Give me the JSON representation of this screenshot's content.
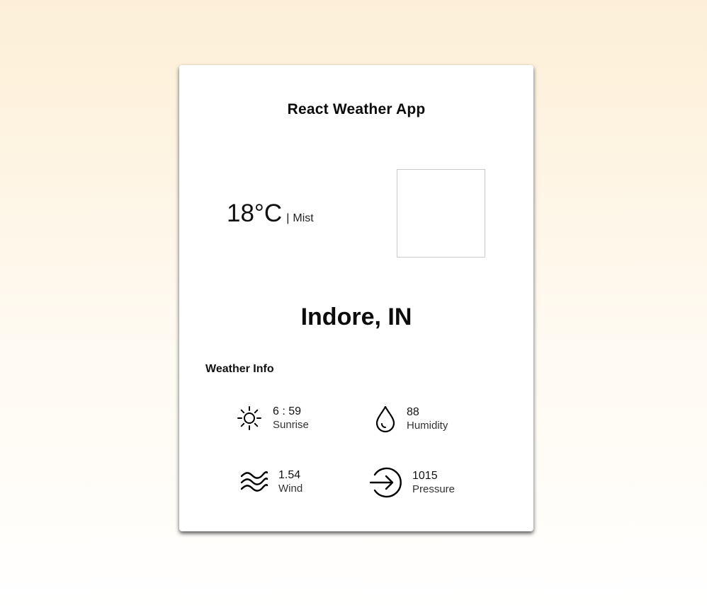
{
  "app": {
    "title": "React Weather App"
  },
  "weather": {
    "temperature": "18°C",
    "separator": "|",
    "condition": "Mist",
    "city": "Indore, IN"
  },
  "info": {
    "heading": "Weather Info",
    "items": [
      {
        "value": "6 : 59",
        "label": "Sunrise",
        "icon": "sun-icon"
      },
      {
        "value": "88",
        "label": "Humidity",
        "icon": "water-drop-icon"
      },
      {
        "value": "1.54",
        "label": "Wind",
        "icon": "wind-waves-icon"
      },
      {
        "value": "1015",
        "label": "Pressure",
        "icon": "arrow-circle-icon"
      }
    ]
  },
  "colors": {
    "background_top": "#fdefd7",
    "background_bottom": "#ffffff",
    "card": "#ffffff",
    "text": "#111111"
  }
}
